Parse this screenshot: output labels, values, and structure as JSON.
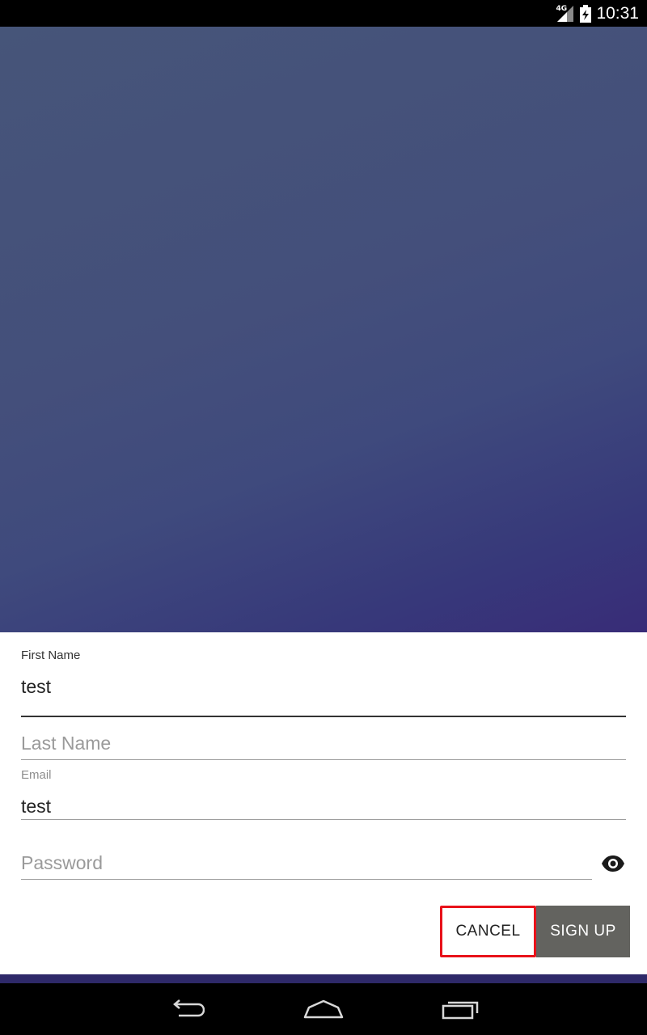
{
  "status_bar": {
    "network": "4G",
    "signal_icon": "cellular-signal-icon",
    "battery_icon": "battery-charging-icon",
    "time": "10:31"
  },
  "hero": {
    "gradient_colors": [
      "#465579",
      "#444f7b",
      "#3f4a7d",
      "#37397a",
      "#382c78"
    ]
  },
  "form": {
    "first_name": {
      "label": "First Name",
      "value": "test"
    },
    "last_name": {
      "placeholder": "Last Name",
      "value": ""
    },
    "email": {
      "label": "Email",
      "value": "test"
    },
    "password": {
      "placeholder": "Password",
      "value": "",
      "toggle_icon": "eye-icon"
    },
    "buttons": {
      "cancel": "CANCEL",
      "sign_up": "SIGN UP"
    }
  },
  "colors": {
    "highlight_border": "#e8121a",
    "signup_bg": "#63635f",
    "bottom_strip": "#2e2969"
  },
  "nav_bar": {
    "icons": [
      "back-icon",
      "home-icon",
      "recents-icon"
    ]
  }
}
